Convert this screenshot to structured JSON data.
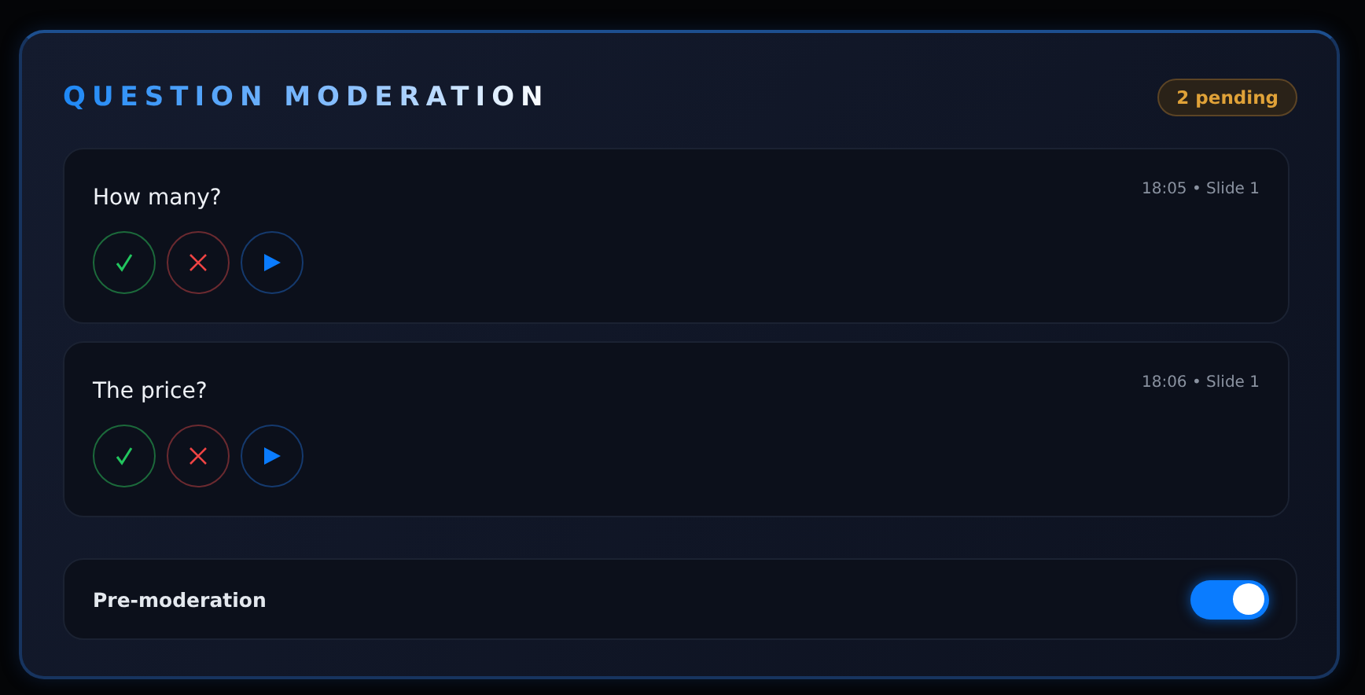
{
  "title": "QUESTION MODERATION",
  "pending_badge": "2 pending",
  "questions": [
    {
      "text": "How many?",
      "meta": "18:05 • Slide 1"
    },
    {
      "text": "The price?",
      "meta": "18:06 • Slide 1"
    }
  ],
  "pre_moderation": {
    "label": "Pre-moderation",
    "on": true
  }
}
